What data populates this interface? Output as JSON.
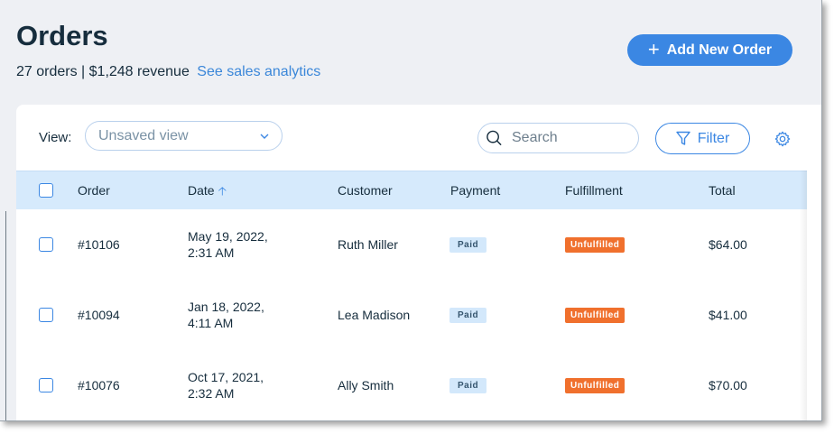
{
  "header": {
    "title": "Orders",
    "summary": "27 orders | $1,248 revenue",
    "analytics_link": "See sales analytics",
    "add_button": "Add New Order"
  },
  "toolbar": {
    "view_label": "View:",
    "view_value": "Unsaved view",
    "search_placeholder": "Search",
    "filter_label": "Filter"
  },
  "table": {
    "columns": [
      "Order",
      "Date",
      "Customer",
      "Payment",
      "Fulfillment",
      "Total"
    ],
    "rows": [
      {
        "order": "#10106",
        "date_line1": "May 19, 2022,",
        "date_line2": "2:31 AM",
        "customer": "Ruth Miller",
        "payment": "Paid",
        "fulfillment": "Unfulfilled",
        "total": "$64.00"
      },
      {
        "order": "#10094",
        "date_line1": "Jan 18, 2022,",
        "date_line2": "4:11 AM",
        "customer": "Lea Madison",
        "payment": "Paid",
        "fulfillment": "Unfulfilled",
        "total": "$41.00"
      },
      {
        "order": "#10076",
        "date_line1": "Oct 17, 2021,",
        "date_line2": "2:32 AM",
        "customer": "Ally Smith",
        "payment": "Paid",
        "fulfillment": "Unfulfilled",
        "total": "$70.00"
      }
    ]
  },
  "colors": {
    "accent": "#3b87e3",
    "header_row": "#d6eafc",
    "paid_badge": "#d3e8fb",
    "unfulfilled_badge": "#f0702d",
    "page_bg": "#eef0f4"
  },
  "icons": [
    "plus-icon",
    "chevron-down-icon",
    "search-icon",
    "filter-icon",
    "gear-icon",
    "sort-up-icon"
  ]
}
